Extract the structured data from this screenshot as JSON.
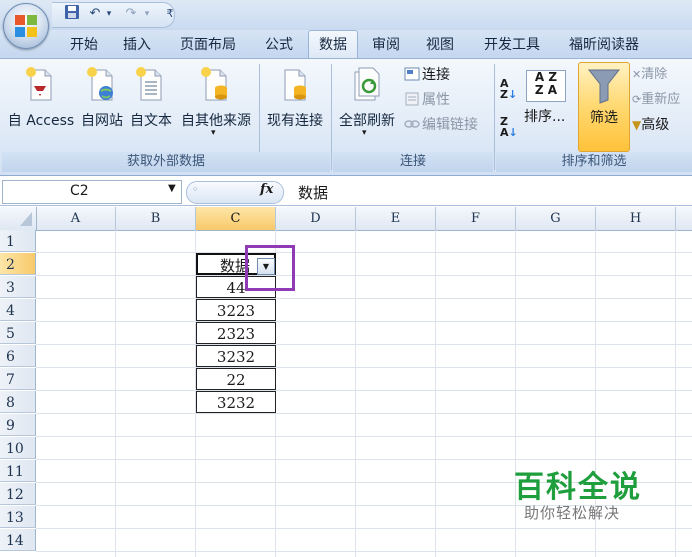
{
  "quick_access": {
    "customize_glyph": "₹"
  },
  "tabs": [
    {
      "label": "开始"
    },
    {
      "label": "插入"
    },
    {
      "label": "页面布局"
    },
    {
      "label": "公式"
    },
    {
      "label": "数据"
    },
    {
      "label": "审阅"
    },
    {
      "label": "视图"
    },
    {
      "label": "开发工具"
    },
    {
      "label": "福昕阅读器"
    }
  ],
  "ribbon": {
    "groups": {
      "external": "获取外部数据",
      "connections": "连接",
      "sort_filter": "排序和筛选"
    },
    "external": {
      "access": "自 Access",
      "web": "自网站",
      "text": "自文本",
      "other": "自其他来源",
      "existing": "现有连接"
    },
    "connections": {
      "refresh_all": "全部刷新",
      "connections": "连接",
      "properties": "属性",
      "edit_links": "编辑链接"
    },
    "sort_filter": {
      "sort": "排序...",
      "filter": "筛选",
      "clear": "清除",
      "reapply": "重新应",
      "advanced": "高级",
      "az": "A Z",
      "za": "Z A"
    }
  },
  "formula_bar": {
    "name_box": "C2",
    "fx": "fx",
    "content": "数据"
  },
  "sheet": {
    "columns": [
      "A",
      "B",
      "C",
      "D",
      "E",
      "F",
      "G",
      "H"
    ],
    "rows": [
      "1",
      "2",
      "3",
      "4",
      "5",
      "6",
      "7",
      "8",
      "9",
      "10",
      "11",
      "12",
      "13",
      "14"
    ],
    "data_header": "数据",
    "values": [
      "44",
      "3223",
      "2323",
      "3232",
      "22",
      "3232"
    ]
  },
  "watermark": {
    "main": "百科全说",
    "sub": "助你轻松解决"
  },
  "colors": {
    "highlight": "#8e3bb5",
    "selected_header": "#f8c96a",
    "watermark": "#1e9e3c"
  }
}
